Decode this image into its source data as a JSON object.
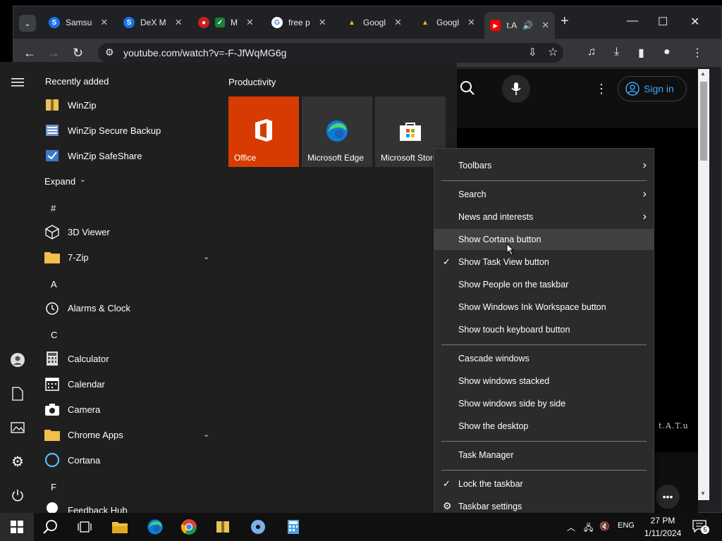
{
  "browser": {
    "tabs": [
      {
        "title": "Samsu",
        "favicon_color": "#1a73e8",
        "favicon_letter": "S"
      },
      {
        "title": "DeX M",
        "favicon_color": "#1a73e8",
        "favicon_letter": "S"
      },
      {
        "title": "M",
        "favicon_color": "#d93025",
        "favicon_letter": "M"
      },
      {
        "title": "free p",
        "favicon_color": "#ffffff",
        "favicon_letter": "G"
      },
      {
        "title": "Googl",
        "favicon_color": "#34a853",
        "favicon_letter": "▲"
      },
      {
        "title": "Googl",
        "favicon_color": "#34a853",
        "favicon_letter": "▲"
      },
      {
        "title": "t.A",
        "favicon_color": "#ff0000",
        "favicon_letter": "▶"
      }
    ],
    "new_tab": "+",
    "url": "youtube.com/watch?v=-F-JfWqMG6g"
  },
  "youtube": {
    "sign_in": "Sign in",
    "side_text": "t.A.T.u"
  },
  "start_menu": {
    "recently_added": "Recently added",
    "recent": [
      {
        "label": "WinZip",
        "icon": "winzip-icon"
      },
      {
        "label": "WinZip Secure Backup",
        "icon": "winzip-backup-icon"
      },
      {
        "label": "WinZip SafeShare",
        "icon": "winzip-safeshare-icon"
      }
    ],
    "expand": "Expand",
    "groups": [
      {
        "header": "#",
        "items": [
          {
            "label": "3D Viewer"
          },
          {
            "label": "7-Zip",
            "expandable": true
          }
        ]
      },
      {
        "header": "A",
        "items": [
          {
            "label": "Alarms & Clock"
          }
        ]
      },
      {
        "header": "C",
        "items": [
          {
            "label": "Calculator"
          },
          {
            "label": "Calendar"
          },
          {
            "label": "Camera"
          },
          {
            "label": "Chrome Apps",
            "expandable": true
          },
          {
            "label": "Cortana"
          }
        ]
      },
      {
        "header": "F",
        "items": [
          {
            "label": "Feedback Hub"
          }
        ]
      }
    ],
    "productivity": "Productivity",
    "tiles": [
      {
        "label": "Office",
        "color": "#d83b01"
      },
      {
        "label": "Microsoft Edge",
        "color": "#2b2b2b"
      },
      {
        "label": "Microsoft Store",
        "color": "#2b2b2b"
      }
    ]
  },
  "context_menu": {
    "items": [
      {
        "label": "Toolbars",
        "submenu": true
      },
      {
        "label": "Search",
        "submenu": true
      },
      {
        "label": "News and interests",
        "submenu": true
      },
      {
        "label": "Show Cortana button",
        "hover": true
      },
      {
        "label": "Show Task View button",
        "checked": true
      },
      {
        "label": "Show People on the taskbar"
      },
      {
        "label": "Show Windows Ink Workspace button"
      },
      {
        "label": "Show touch keyboard button"
      },
      {
        "label": "Cascade windows"
      },
      {
        "label": "Show windows stacked"
      },
      {
        "label": "Show windows side by side"
      },
      {
        "label": "Show the desktop"
      },
      {
        "label": "Task Manager"
      },
      {
        "label": "Lock the taskbar",
        "checked": true
      },
      {
        "label": "Taskbar settings"
      }
    ],
    "check": "✓",
    "arrow": "›"
  },
  "taskbar": {
    "time": "27 PM",
    "date": "1/11/2024",
    "language": "ENG",
    "notification_count": "5"
  }
}
